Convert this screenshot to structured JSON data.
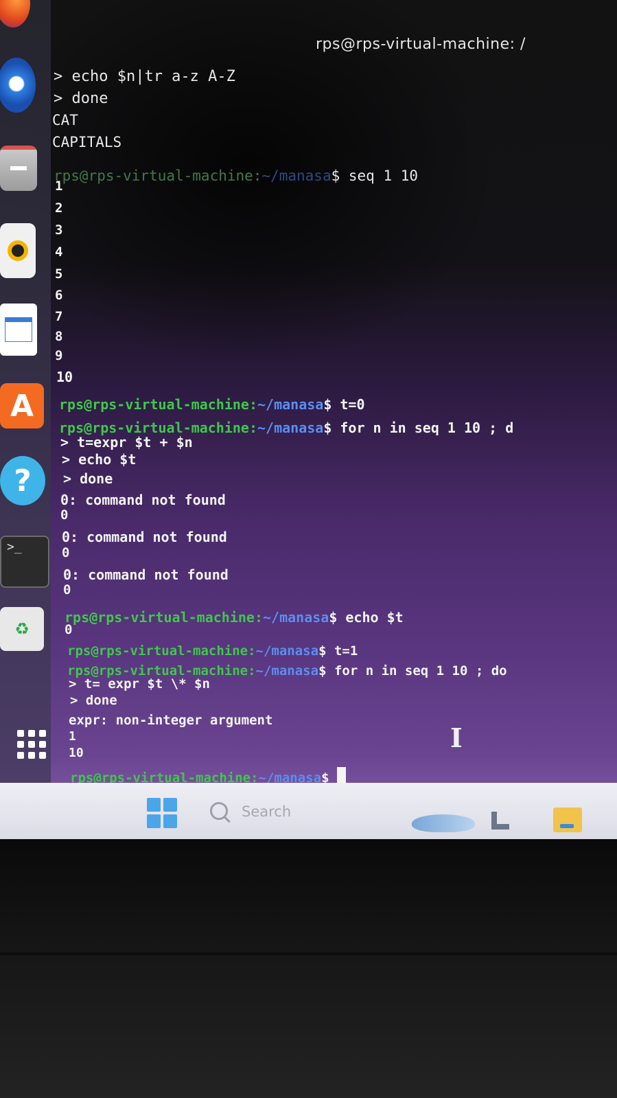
{
  "window": {
    "title": "rps@rps-virtual-machine: /"
  },
  "terminal": {
    "lines": [
      {
        "type": "cont",
        "text": "> echo $n|tr a-z A-Z"
      },
      {
        "type": "cont",
        "text": "> done"
      },
      {
        "type": "out",
        "text": "CAT"
      },
      {
        "type": "out",
        "text": "CAPITALS"
      },
      {
        "type": "prompt",
        "user": "rps@rps-virtual-machine:",
        "path": "~/manasa",
        "cmd": "$ seq 1 10"
      },
      {
        "type": "out",
        "text": "1"
      },
      {
        "type": "out",
        "text": "2"
      },
      {
        "type": "out",
        "text": "3"
      },
      {
        "type": "out",
        "text": "4"
      },
      {
        "type": "out",
        "text": "5"
      },
      {
        "type": "out",
        "text": "6"
      },
      {
        "type": "out",
        "text": "7"
      },
      {
        "type": "out",
        "text": "8"
      },
      {
        "type": "out",
        "text": "9"
      },
      {
        "type": "out",
        "text": "10"
      },
      {
        "type": "prompt",
        "user": "rps@rps-virtual-machine:",
        "path": "~/manasa",
        "cmd": "$ t=0"
      },
      {
        "type": "prompt",
        "user": "rps@rps-virtual-machine:",
        "path": "~/manasa",
        "cmd": "$ for n in seq 1 10 ; d"
      },
      {
        "type": "cont",
        "text": "> t=expr $t + $n"
      },
      {
        "type": "cont",
        "text": "> echo $t"
      },
      {
        "type": "cont",
        "text": "> done"
      },
      {
        "type": "out",
        "text": "0: command not found"
      },
      {
        "type": "out",
        "text": "0"
      },
      {
        "type": "out",
        "text": "0: command not found"
      },
      {
        "type": "out",
        "text": "0"
      },
      {
        "type": "out",
        "text": "0: command not found"
      },
      {
        "type": "out",
        "text": "0"
      },
      {
        "type": "prompt",
        "user": "rps@rps-virtual-machine:",
        "path": "~/manasa",
        "cmd": "$ echo $t"
      },
      {
        "type": "out",
        "text": "0"
      },
      {
        "type": "prompt",
        "user": "rps@rps-virtual-machine:",
        "path": "~/manasa",
        "cmd": "$ t=1"
      },
      {
        "type": "prompt",
        "user": "rps@rps-virtual-machine:",
        "path": "~/manasa",
        "cmd": "$ for n in seq 1 10 ; do"
      },
      {
        "type": "cont",
        "text": "> t= expr $t \\* $n"
      },
      {
        "type": "cont",
        "text": "> done"
      },
      {
        "type": "out",
        "text": "expr: non-integer argument"
      },
      {
        "type": "out",
        "text": "1"
      },
      {
        "type": "out",
        "text": "10"
      },
      {
        "type": "prompt",
        "user": "rps@rps-virtual-machine:",
        "path": "~/manasa",
        "cmd": "$ "
      }
    ]
  },
  "dock": {
    "terminal_label": ">_",
    "appcenter_label": "A",
    "help_label": "?",
    "trash_label": "♻"
  },
  "taskbar": {
    "search_label": "Search"
  },
  "colors": {
    "prompt_user": "#3ec84a",
    "prompt_path": "#5a8ef0",
    "text": "#f4f4f4"
  }
}
